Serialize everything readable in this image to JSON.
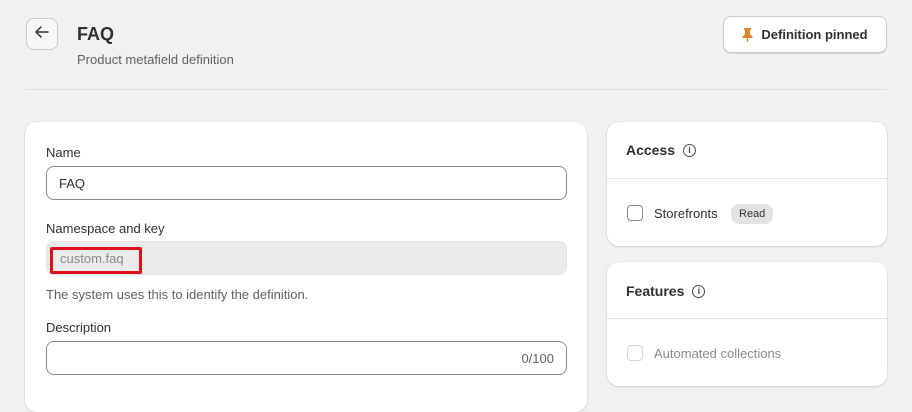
{
  "header": {
    "back_icon": "arrow-left-icon",
    "title": "FAQ",
    "subtitle": "Product metafield definition",
    "pin_button": {
      "label": "Definition pinned",
      "icon": "pin-icon",
      "icon_color": "#e0862a"
    }
  },
  "form": {
    "name": {
      "label": "Name",
      "value": "FAQ"
    },
    "namespace": {
      "label": "Namespace and key",
      "value": "custom.faq",
      "help": "The system uses this to identify the definition.",
      "highlight_color": "#e0101a"
    },
    "description": {
      "label": "Description",
      "value": "",
      "counter": "0/100"
    }
  },
  "access": {
    "title": "Access",
    "info_icon": "info-icon",
    "storefronts": {
      "label": "Storefronts",
      "checked": false,
      "badge": "Read"
    }
  },
  "features": {
    "title": "Features",
    "info_icon": "info-icon",
    "automated_collections": {
      "label": "Automated collections",
      "checked": false,
      "disabled": true
    }
  }
}
